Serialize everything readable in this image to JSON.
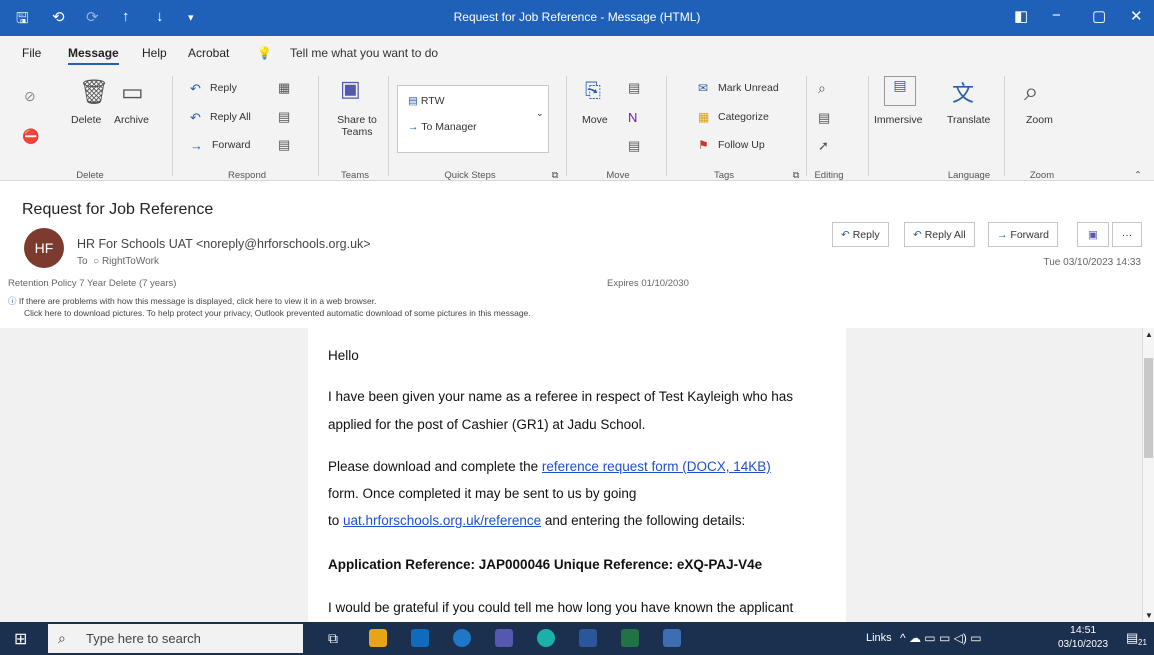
{
  "window": {
    "title": "Request for Job Reference  -  Message (HTML)",
    "quick_access": [
      "🖫",
      "⟲",
      "⟳",
      "↑",
      "↓",
      "≡"
    ],
    "controls": [
      "◧",
      "−",
      "▢",
      "✕"
    ]
  },
  "menu": {
    "items": [
      "File",
      "Message",
      "Help",
      "Acrobat"
    ],
    "active": "Message",
    "tell_me": "Tell me what you want to do"
  },
  "ribbon": {
    "groups": {
      "delete": "Delete",
      "respond": "Respond",
      "teams": "Teams",
      "quick_steps": "Quick Steps",
      "move": "Move",
      "tags": "Tags",
      "editing": "Editing",
      "language": "Language",
      "zoom": "Zoom"
    },
    "delete_label": "Delete",
    "archive_label": "Archive",
    "reply_label": "Reply",
    "reply_all_label": "Reply All",
    "forward_label": "Forward",
    "share_to_teams_label": "Share to Teams",
    "qs_rtw": "RTW",
    "qs_to_manager": "To Manager",
    "move_label": "Move",
    "mark_unread_label": "Mark Unread",
    "categorize_label": "Categorize",
    "follow_up_label": "Follow Up",
    "immersive_label": "Immersive",
    "translate_label": "Translate",
    "zoom_label": "Zoom"
  },
  "message": {
    "subject": "Request for Job Reference",
    "avatar_initials": "HF",
    "from": "HR For Schools UAT <noreply@hrforschools.org.uk>",
    "to_label": "To",
    "to": "RightToWork",
    "retention": "Retention Policy   7 Year Delete (7 years)",
    "expires": "Expires   01/10/2030",
    "info_line1": "If there are problems with how this message is displayed, click here to view it in a web browser.",
    "info_line2": "Click here to download pictures. To help protect your privacy, Outlook prevented automatic download of some pictures in this message.",
    "date": "Tue 03/10/2023 14:33",
    "actions": {
      "reply": "Reply",
      "reply_all": "Reply All",
      "forward": "Forward",
      "more": "···"
    }
  },
  "body": {
    "greeting": "Hello",
    "line1": "I have been given your name as a referee in respect of Test Kayleigh who has",
    "line2": "applied for the post of Cashier (GR1) at Jadu School.",
    "line3_pre": "Please download and complete the ",
    "line3_link": "reference request form (DOCX, 14KB)",
    "line4": "form. Once completed it may be sent to us by going",
    "line5_pre": "to ",
    "line5_link": "uat.hrforschools.org.uk/reference",
    "line5_post": " and entering the following details:",
    "app_ref": "Application Reference: JAP000046 Unique Reference: eXQ-PAJ-V4e",
    "line6": "I would be grateful if you could tell me how long you have known the applicant"
  },
  "taskbar": {
    "search_placeholder": "Type here to search",
    "links": "Links",
    "time": "14:51",
    "date": "03/10/2023",
    "notif_count": "21"
  },
  "colors": {
    "titlebar": "#1f60b8",
    "taskbar": "#1b2f4e",
    "link": "#1f4fcc",
    "avatar": "#7c3b2e"
  }
}
